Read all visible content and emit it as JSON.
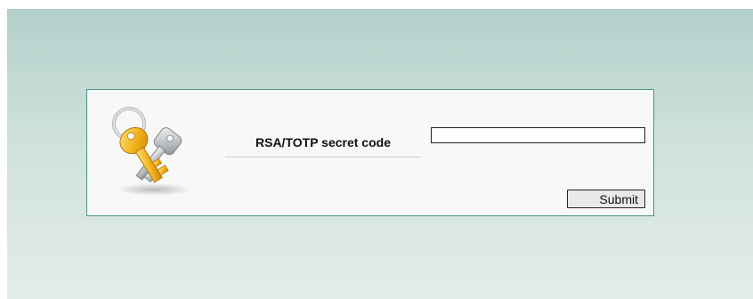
{
  "login_form": {
    "icon": "key-icon",
    "field_label": "RSA/TOTP secret code",
    "code_value": "",
    "code_placeholder": "",
    "submit_label": "Submit"
  },
  "colors": {
    "panel_border": "#4a9386",
    "backdrop_top": "#b3d0ca",
    "backdrop_bottom": "#e4ecea"
  }
}
